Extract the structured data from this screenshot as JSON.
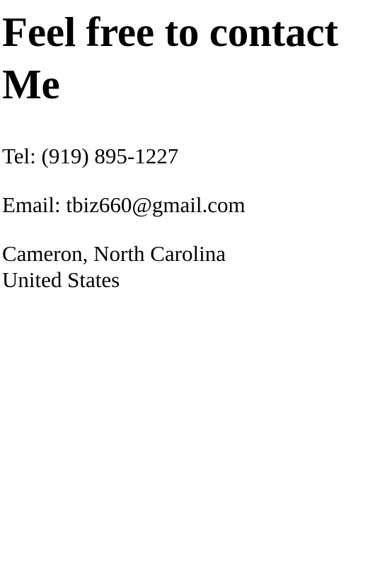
{
  "heading": "Feel free to contact Me",
  "contact": {
    "tel": "Tel: (919) 895-1227",
    "email": "Email: tbiz660@gmail.com",
    "address_line1": "Cameron, North Carolina",
    "address_line2": "United States"
  },
  "colors": {
    "background": "#ffffff",
    "text": "#000000"
  }
}
